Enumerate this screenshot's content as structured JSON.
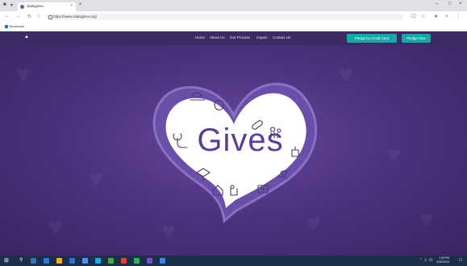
{
  "browser": {
    "tab_title": "vitalsgives",
    "url": "https://www.vitalsgives.org/",
    "bookmark": "Bookmark"
  },
  "site": {
    "menu": [
      "Home",
      "About Us",
      "Our Process",
      "Impact",
      "Contact Us"
    ],
    "cta_primary": "Pledge by Credit Card",
    "cta_secondary": "Pledge Now"
  },
  "hero": {
    "logo_text": "Gives"
  },
  "taskbar": {
    "time": "1:48 PM",
    "date": "6/30/2023"
  },
  "colors": {
    "nav_bg": "#3d2a64",
    "hero_bg": "#4d3380",
    "cta": "#1aa6a6",
    "logo_text": "#5c3d95"
  }
}
